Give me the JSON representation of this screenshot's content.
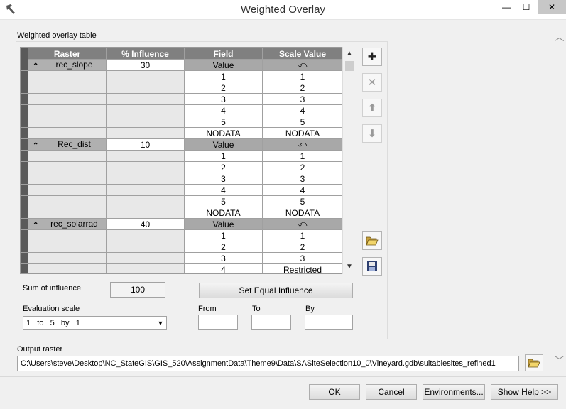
{
  "window": {
    "title": "Weighted Overlay",
    "minimize": "—",
    "maximize": "☐",
    "close": "✕"
  },
  "panel_label": "Weighted overlay table",
  "columns": [
    "Raster",
    "% Influence",
    "Field",
    "Scale Value"
  ],
  "rasters": [
    {
      "name": "rec_slope",
      "influence": "30",
      "field_header": "Value",
      "scale_header": "⤺",
      "rows": [
        {
          "field": "1",
          "scale": "1"
        },
        {
          "field": "2",
          "scale": "2"
        },
        {
          "field": "3",
          "scale": "3"
        },
        {
          "field": "4",
          "scale": "4"
        },
        {
          "field": "5",
          "scale": "5"
        },
        {
          "field": "NODATA",
          "scale": "NODATA"
        }
      ]
    },
    {
      "name": "Rec_dist",
      "influence": "10",
      "field_header": "Value",
      "scale_header": "⤺",
      "rows": [
        {
          "field": "1",
          "scale": "1"
        },
        {
          "field": "2",
          "scale": "2"
        },
        {
          "field": "3",
          "scale": "3"
        },
        {
          "field": "4",
          "scale": "4"
        },
        {
          "field": "5",
          "scale": "5"
        },
        {
          "field": "NODATA",
          "scale": "NODATA"
        }
      ]
    },
    {
      "name": "rec_solarrad",
      "influence": "40",
      "field_header": "Value",
      "scale_header": "⤺",
      "rows": [
        {
          "field": "1",
          "scale": "1"
        },
        {
          "field": "2",
          "scale": "2"
        },
        {
          "field": "3",
          "scale": "3"
        },
        {
          "field": "4",
          "scale": "Restricted"
        }
      ]
    }
  ],
  "sum_of_influence": {
    "label": "Sum of influence",
    "value": "100"
  },
  "set_equal_button": "Set Equal Influence",
  "evaluation_scale": {
    "label": "Evaluation scale",
    "selected": "1   to   5   by   1"
  },
  "range": {
    "from_label": "From",
    "to_label": "To",
    "by_label": "By",
    "from": "",
    "to": "",
    "by": ""
  },
  "output_raster": {
    "label": "Output raster",
    "value": "C:\\Users\\steve\\Desktop\\NC_StateGIS\\GIS_520\\AssignmentData\\Theme9\\Data\\SASiteSelection10_0\\Vineyard.gdb\\suitablesites_refined1"
  },
  "buttons": {
    "ok": "OK",
    "cancel": "Cancel",
    "environments": "Environments...",
    "show_help": "Show Help >>"
  },
  "icons": {
    "add": "+",
    "remove": "✕",
    "up": "⬆",
    "down": "⬇"
  }
}
